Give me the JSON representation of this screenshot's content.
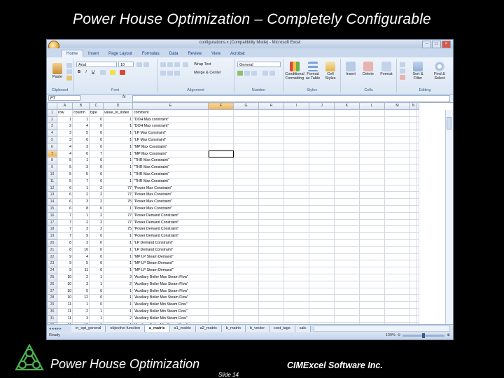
{
  "slide": {
    "title": "Power House Optimization – Completely Configurable",
    "footer_left": "Power House Optimization",
    "footer_right": "CIMExcel Software Inc.",
    "slide_number": "Slide 14"
  },
  "excel": {
    "window_title": "configurations.x (Compatibility Mode) - Microsoft Excel",
    "ribbon_tabs": [
      "Home",
      "Insert",
      "Page Layout",
      "Formulas",
      "Data",
      "Review",
      "View",
      "Acrobat"
    ],
    "active_tab": "Home",
    "ribbon": {
      "paste": "Paste",
      "font_name": "Arial",
      "font_size": "10",
      "wrap_text": "Wrap Text",
      "merge_center": "Merge & Center",
      "number_format": "General",
      "conditional_formatting": "Conditional Formatting",
      "format_as_table": "Format as Table",
      "cell_styles": "Cell Styles",
      "insert": "Insert",
      "delete": "Delete",
      "format": "Format",
      "sort_filter": "Sort & Filter",
      "find_select": "Find & Select",
      "groups": [
        "Clipboard",
        "Font",
        "Alignment",
        "Number",
        "Styles",
        "Cells",
        "Editing"
      ]
    },
    "name_box": "F7",
    "formula_fx": "fx",
    "columns": [
      "A",
      "B",
      "C",
      "D",
      "E",
      "F",
      "G",
      "H",
      "I",
      "J",
      "K",
      "L",
      "M",
      "N"
    ],
    "selected_column": "F",
    "selected_row": 7,
    "rows": [
      [
        "row",
        "column",
        "type",
        "value_or_index",
        "comment"
      ],
      [
        "1",
        "1",
        "0",
        "1",
        "\"DOH Max constraint\""
      ],
      [
        "2",
        "4",
        "0",
        "1",
        "\"DOH Max constraint\""
      ],
      [
        "3",
        "5",
        "0",
        "1",
        "\"LP Max Constraint\""
      ],
      [
        "3",
        "6",
        "0",
        "1",
        "\"LP Max Constraint\""
      ],
      [
        "4",
        "3",
        "0",
        "1",
        "\"MP Max Constraint\""
      ],
      [
        "4",
        "6",
        "7",
        "1",
        "\"MP Max Constraint\""
      ],
      [
        "5",
        "1",
        "0",
        "1",
        "\"THR Max Constraint\""
      ],
      [
        "5",
        "3",
        "0",
        "1",
        "\"THR Max Constraint\""
      ],
      [
        "5",
        "5",
        "0",
        "1",
        "\"THR Max Constraint\""
      ],
      [
        "5",
        "7",
        "0",
        "1",
        "\"THR Max Constraint\""
      ],
      [
        "6",
        "1",
        "2",
        "77",
        "\"Power Max Constraint\""
      ],
      [
        "6",
        "2",
        "2",
        "77",
        "\"Power Max Constraint\""
      ],
      [
        "6",
        "3",
        "2",
        "75",
        "\"Power Max Constraint\""
      ],
      [
        "6",
        "8",
        "0",
        "1",
        "\"Power Max Constraint\""
      ],
      [
        "7",
        "1",
        "2",
        "77",
        "\"Power Demand Constraint\""
      ],
      [
        "7",
        "2",
        "2",
        "77",
        "\"Power Demand Constraint\""
      ],
      [
        "7",
        "3",
        "2",
        "75",
        "\"Power Demand Constraint\""
      ],
      [
        "7",
        "9",
        "0",
        "1",
        "\"Power Demand Constraint\""
      ],
      [
        "8",
        "3",
        "0",
        "1",
        "\"LP Demand Constraint\""
      ],
      [
        "8",
        "10",
        "0",
        "1",
        "\"LP Demand Constraint\""
      ],
      [
        "9",
        "4",
        "0",
        "1",
        "\"MP LP Steam Demand\""
      ],
      [
        "9",
        "5",
        "0",
        "1",
        "\"MP LP Steam Demand\""
      ],
      [
        "9",
        "11",
        "0",
        "1",
        "\"MP LP Steam Demand\""
      ],
      [
        "10",
        "2",
        "1",
        "3",
        "\"Auxiliary Boiler Max Steam Flow\""
      ],
      [
        "10",
        "3",
        "1",
        "2",
        "\"Auxiliary Boiler Max Steam Flow\""
      ],
      [
        "10",
        "5",
        "0",
        "1",
        "\"Auxiliary Boiler Max Steam Flow\""
      ],
      [
        "10",
        "12",
        "0",
        "1",
        "\"Auxiliary Boiler Max Steam Flow\""
      ],
      [
        "11",
        "1",
        "0",
        "1",
        "\"Auxiliary Boiler Min Steam Flow\""
      ],
      [
        "11",
        "2",
        "1",
        "1",
        "\"Auxiliary Boiler Min Steam Flow\""
      ],
      [
        "11",
        "3",
        "1",
        "2",
        "\"Auxiliary Boiler Min Steam Flow\""
      ],
      [
        "11",
        "13",
        "0",
        "1",
        "\"Auxiliary Boiler Min Steam Flow\""
      ]
    ],
    "sheet_tabs": [
      "in_opt_general",
      "objective function",
      "a_matrix",
      "a1_matrix",
      "a2_matrix",
      "b_matrix",
      "b_vector",
      "cost_tags",
      "calc"
    ],
    "active_sheet": "a_matrix",
    "status": "Ready",
    "zoom": "100%"
  },
  "colors": {
    "background": "#000000",
    "text": "#ffffff",
    "logo": "#4caf50"
  }
}
